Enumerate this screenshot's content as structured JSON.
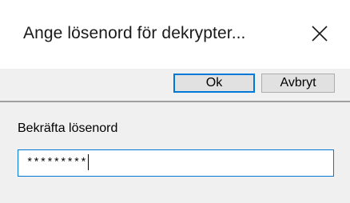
{
  "window": {
    "title": "Ange lösenord för dekrypter...",
    "close_icon": "close-icon"
  },
  "toolbar": {
    "ok_label": "Ok",
    "cancel_label": "Avbryt"
  },
  "form": {
    "password_label": "Bekräfta lösenord",
    "password_value": "*********"
  },
  "colors": {
    "focus_accent": "#0078d7",
    "dialog_background": "#f0f0f0",
    "title_background": "#ffffff"
  }
}
